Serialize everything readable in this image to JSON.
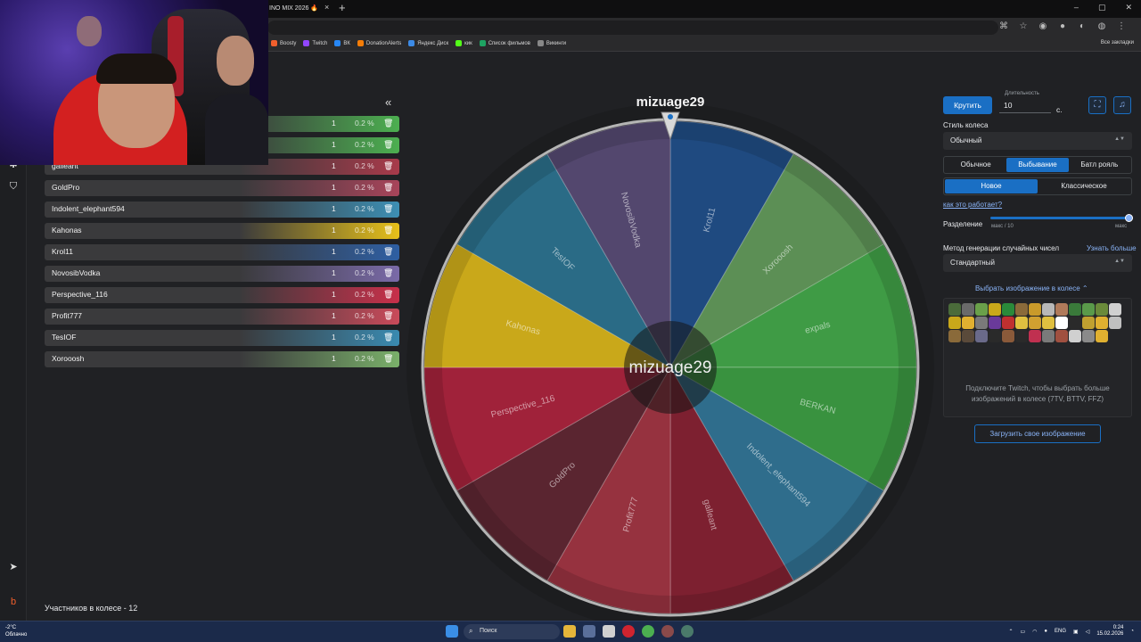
{
  "browser": {
    "tab_title": "INO MIX 2026 🔥",
    "tab_close": "×",
    "tab_new": "+",
    "window_controls": [
      "–",
      "▢",
      "✕"
    ],
    "bookmarks": [
      {
        "label": "Boosty",
        "color": "#f15f2c"
      },
      {
        "label": "Twitch",
        "color": "#9146ff"
      },
      {
        "label": "ВК",
        "color": "#2787f5"
      },
      {
        "label": "DonationAlerts",
        "color": "#f57d07"
      },
      {
        "label": "Яндекс Диск",
        "color": "#3c8ae5"
      },
      {
        "label": "кик",
        "color": "#53fc18"
      },
      {
        "label": "Список фильмов",
        "color": "#1ea362"
      },
      {
        "label": "Викинги",
        "color": "#888888"
      }
    ],
    "all_bookmarks": "Все закладки"
  },
  "collapse_icon": "«",
  "participants": [
    {
      "name": "",
      "count": "1",
      "pct": "0.2 %",
      "color": "#4caf50"
    },
    {
      "name": "",
      "count": "1",
      "pct": "0.2 %",
      "color": "#4caf50"
    },
    {
      "name": "galleant",
      "count": "1",
      "pct": "0.2 %",
      "color": "#a83a4a"
    },
    {
      "name": "GoldPro",
      "count": "1",
      "pct": "0.2 %",
      "color": "#a8445a"
    },
    {
      "name": "Indolent_elephant594",
      "count": "1",
      "pct": "0.2 %",
      "color": "#3d8fb4"
    },
    {
      "name": "Kahonas",
      "count": "1",
      "pct": "0.2 %",
      "color": "#e6c01a"
    },
    {
      "name": "Krol11",
      "count": "1",
      "pct": "0.2 %",
      "color": "#2e5fa3"
    },
    {
      "name": "NovosibVodka",
      "count": "1",
      "pct": "0.2 %",
      "color": "#7a6aa8"
    },
    {
      "name": "Perspective_116",
      "count": "1",
      "pct": "0.2 %",
      "color": "#c8304a"
    },
    {
      "name": "Profit777",
      "count": "1",
      "pct": "0.2 %",
      "color": "#c94a5a"
    },
    {
      "name": "TesIOF",
      "count": "1",
      "pct": "0.2 %",
      "color": "#3a8ab0"
    },
    {
      "name": "Xorooosh",
      "count": "1",
      "pct": "0.2 %",
      "color": "#7ab06a"
    }
  ],
  "participants_count_label": "Участников в колесе - 12",
  "wheel": {
    "winner_top": "mizuage29",
    "center_text": "mizuage29",
    "segments": [
      {
        "label": "Krol11",
        "color": "#1f4a80"
      },
      {
        "label": "Xorooosh",
        "color": "#5c8f55"
      },
      {
        "label": "expals",
        "color": "#3f9b45"
      },
      {
        "label": "BERKAN",
        "color": "#39923f"
      },
      {
        "label": "Indolent_elephant594",
        "color": "#2f6d8c"
      },
      {
        "label": "galleant",
        "color": "#7d2030"
      },
      {
        "label": "Profit777",
        "color": "#96323f"
      },
      {
        "label": "GoldPro",
        "color": "#5a2530"
      },
      {
        "label": "Perspective_116",
        "color": "#a0223a"
      },
      {
        "label": "Kahonas",
        "color": "#c9a81a"
      },
      {
        "label": "TesIOF",
        "color": "#2a6b86"
      },
      {
        "label": "NovosibVodka",
        "color": "#53476e"
      }
    ]
  },
  "controls": {
    "spin_label": "Крутить",
    "duration_label": "Длительность",
    "duration_value": "10",
    "duration_unit": "с.",
    "style_label": "Стиль колеса",
    "style_value": "Обычный",
    "modes": [
      "Обычное",
      "Выбывание",
      "Батл рояль"
    ],
    "active_mode": 1,
    "variants": [
      "Новое",
      "Классическое"
    ],
    "active_variant": 0,
    "how_link": "как это работает?",
    "split_label": "Разделение",
    "split_min": "макс / 10",
    "split_max": "макс",
    "split_level": 1.0,
    "rng_label": "Метод генерации случайных чисел",
    "rng_link": "Узнать больше",
    "rng_value": "Стандартный",
    "image_toggle": "Выбрать изображение в колесе ⌃",
    "image_note": "Подключите Twitch, чтобы выбрать больше изображений в колесе (7TV, BTTV, FFZ)",
    "upload_label": "Загрузить свое изображение"
  },
  "taskbar": {
    "temp": "-2°C",
    "weather": "Облачно",
    "search": "Поиск",
    "lang": "ENG",
    "time": "0:24",
    "date": "15.02.2026"
  }
}
